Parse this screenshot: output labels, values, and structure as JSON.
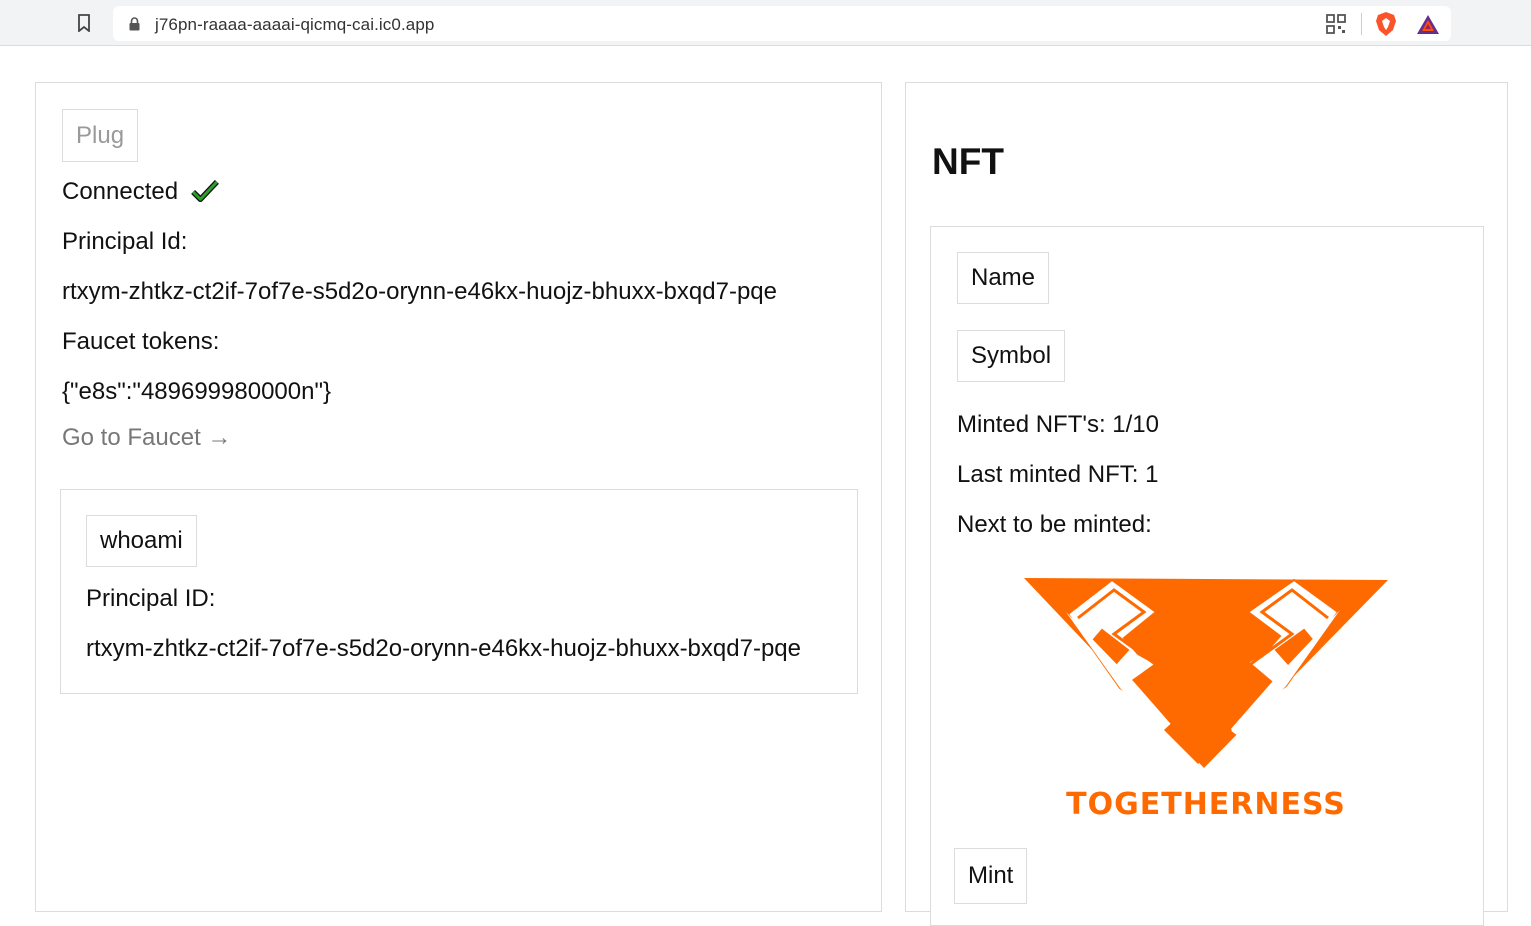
{
  "browser": {
    "url": "j76pn-raaaa-aaaai-qicmq-cai.ic0.app",
    "icons": [
      "bookmark-icon",
      "lock-icon",
      "qr-code-icon",
      "brave-shield-icon",
      "bat-rewards-icon"
    ]
  },
  "wallet": {
    "plug_label": "Plug",
    "status": "Connected",
    "principal_label": "Principal Id:",
    "principal_value": "rtxym-zhtkz-ct2if-7of7e-s5d2o-orynn-e46kx-huojz-bhuxx-bxqd7-pqe",
    "faucet_label": "Faucet tokens:",
    "faucet_value": "{\"e8s\":\"489699980000n\"}",
    "faucet_link": "Go to Faucet →"
  },
  "whoami": {
    "button_label": "whoami",
    "principal_label": "Principal ID:",
    "principal_value": "rtxym-zhtkz-ct2if-7of7e-s5d2o-orynn-e46kx-huojz-bhuxx-bxqd7-pqe"
  },
  "nft": {
    "title": "NFT",
    "name_button": "Name",
    "symbol_button": "Symbol",
    "minted": "Minted NFT's: 1/10",
    "last_minted": "Last minted NFT: 1",
    "next_label": "Next to be minted:",
    "image_caption": "TOGETHERNESS",
    "mint_button": "Mint"
  },
  "colors": {
    "accent_orange": "#ff6a00",
    "check_green": "#2aa02a",
    "border": "#dcdcdc"
  }
}
